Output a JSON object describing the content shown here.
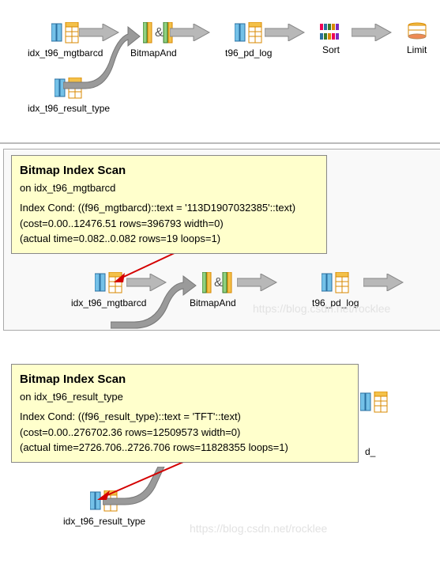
{
  "section1": {
    "nodes": {
      "mgtbarcd": "idx_t96_mgtbarcd",
      "result_type": "idx_t96_result_type",
      "bitmap_and": "BitmapAnd",
      "pd_log": "t96_pd_log",
      "sort": "Sort",
      "limit": "Limit"
    }
  },
  "section2": {
    "tooltip": {
      "title": "Bitmap Index Scan",
      "subtitle": "on idx_t96_mgtbarcd",
      "line1": "Index Cond: ((f96_mgtbarcd)::text = '113D1907032385'::text)",
      "line2": "(cost=0.00..12476.51 rows=396793 width=0)",
      "line3": "(actual time=0.082..0.082 rows=19 loops=1)"
    },
    "nodes": {
      "mgtbarcd": "idx_t96_mgtbarcd",
      "bitmap_and": "BitmapAnd",
      "pd_log": "t96_pd_log"
    },
    "watermark": "https://blog.csdn.net/rocklee"
  },
  "section3": {
    "tooltip": {
      "title": "Bitmap Index Scan",
      "subtitle": "on idx_t96_result_type",
      "line1": "Index Cond: ((f96_result_type)::text = 'TFT'::text)",
      "line2": "(cost=0.00..276702.36 rows=12509573 width=0)",
      "line3": "(actual time=2726.706..2726.706 rows=11828355 loops=1)"
    },
    "nodes": {
      "result_type": "idx_t96_result_type",
      "suffix": "d_"
    },
    "watermark": "https://blog.csdn.net/rocklee"
  }
}
